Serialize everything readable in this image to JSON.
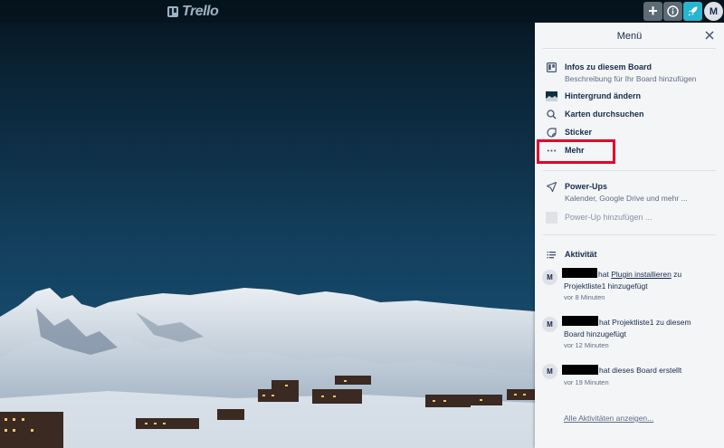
{
  "topbar": {
    "logo_text": "Trello",
    "plus_label": "+",
    "avatar_initial": "M"
  },
  "menu": {
    "title": "Menü",
    "items": [
      {
        "title": "Infos zu diesem Board",
        "subtitle": "Beschreibung für Ihr Board hinzufügen",
        "icon": "board-icon"
      },
      {
        "title": "Hintergrund ändern",
        "icon": "background-thumbnail"
      },
      {
        "title": "Karten durchsuchen",
        "icon": "search-icon"
      },
      {
        "title": "Sticker",
        "icon": "sticker-icon"
      },
      {
        "title": "Mehr",
        "icon": "more-icon"
      }
    ],
    "powerups": {
      "title": "Power-Ups",
      "subtitle": "Kalender, Google Drive und mehr ...",
      "add_label": "Power-Up hinzufügen ..."
    },
    "activity": {
      "title": "Aktivität",
      "entries": [
        {
          "initial": "M",
          "before_link": "hat ",
          "link": "Plugin installieren",
          "after_link": " zu",
          "line2": "Projektliste1 hinzugefügt",
          "time": "vor 8 Minuten"
        },
        {
          "initial": "M",
          "line1": "hat Projektliste1 zu diesem",
          "line2": "Board hinzugefügt",
          "time": "vor 12 Minuten"
        },
        {
          "initial": "M",
          "line1": "hat dieses Board erstellt",
          "time": "vor 19 Minuten"
        }
      ],
      "all_link": "Alle Aktivitäten anzeigen..."
    }
  },
  "colors": {
    "sky_top": "#06131c",
    "sky_bottom": "#15496a",
    "highlight": "#e4002b",
    "rocket_button": "#27b5cf"
  }
}
